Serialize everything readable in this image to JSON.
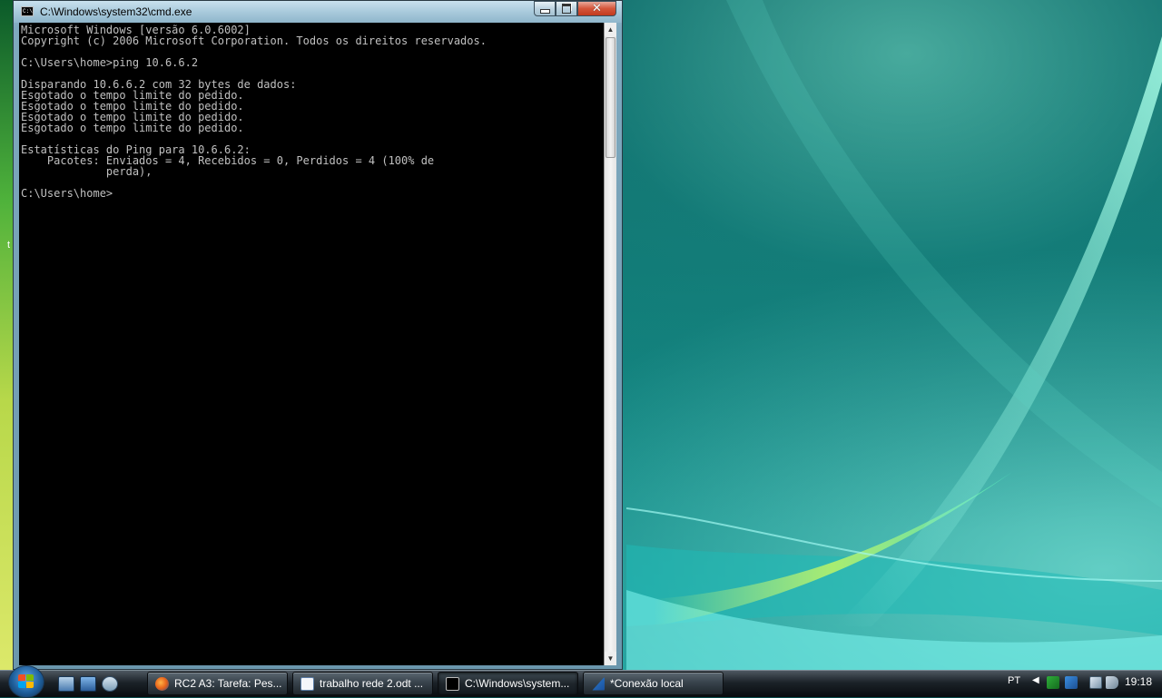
{
  "window": {
    "title": "C:\\Windows\\system32\\cmd.exe",
    "icon": "console-icon",
    "close_symbol": "✕"
  },
  "console": {
    "lines": [
      "Microsoft Windows [versão 6.0.6002]",
      "Copyright (c) 2006 Microsoft Corporation. Todos os direitos reservados.",
      "",
      "C:\\Users\\home>ping 10.6.6.2",
      "",
      "Disparando 10.6.6.2 com 32 bytes de dados:",
      "Esgotado o tempo limite do pedido.",
      "Esgotado o tempo limite do pedido.",
      "Esgotado o tempo limite do pedido.",
      "Esgotado o tempo limite do pedido.",
      "",
      "Estatísticas do Ping para 10.6.6.2:",
      "    Pacotes: Enviados = 4, Recebidos = 0, Perdidos = 4 (100% de",
      "             perda),",
      "",
      "C:\\Users\\home>"
    ]
  },
  "desktop": {
    "left_edge_char": "t"
  },
  "taskbar": {
    "quick_launch": [
      "show-desktop-icon",
      "switch-windows-icon",
      "network-icon"
    ],
    "buttons": [
      {
        "label": "RC2 A3: Tarefa: Pes...",
        "icon": "firefox-icon",
        "active": false
      },
      {
        "label": "trabalho rede 2.odt ...",
        "icon": "document-icon",
        "active": false
      },
      {
        "label": "C:\\Windows\\system...",
        "icon": "console-icon",
        "active": true
      },
      {
        "label": "*Conexão local",
        "icon": "wireshark-icon",
        "active": false
      }
    ],
    "language": "PT",
    "clock": "19:18"
  },
  "colors": {
    "console_bg": "#000000",
    "console_fg": "#c0c0c0",
    "taskbar": "#1b2228",
    "accent": "#3fd6b8"
  }
}
